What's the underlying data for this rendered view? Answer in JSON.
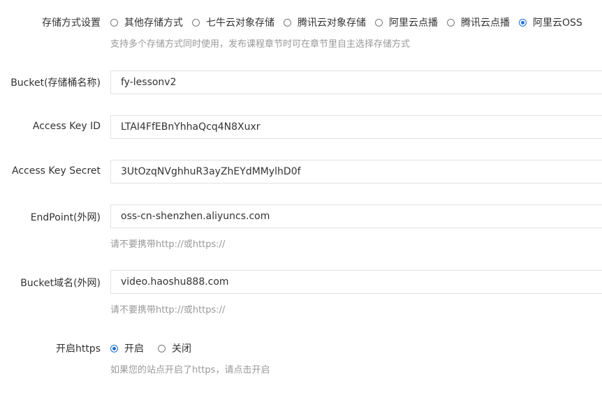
{
  "storage": {
    "label": "存储方式设置",
    "options": [
      "其他存储方式",
      "七牛云对象存储",
      "腾讯云对象存储",
      "阿里云点播",
      "腾讯云点播",
      "阿里云OSS"
    ],
    "hint": "支持多个存储方式同时使用，发布课程章节时可在章节里自主选择存储方式"
  },
  "bucket": {
    "label": "Bucket(存储桶名称)",
    "value": "fy-lessonv2"
  },
  "access_key_id": {
    "label": "Access Key ID",
    "value": "LTAI4FfEBnYhhaQcq4N8Xuxr"
  },
  "access_key_secret": {
    "label": "Access Key Secret",
    "value": "3UtOzqNVghhuR3ayZhEYdMMylhD0f"
  },
  "endpoint": {
    "label": "EndPoint(外网)",
    "value": "oss-cn-shenzhen.aliyuncs.com",
    "hint": "请不要携带http://或https://"
  },
  "bucket_domain": {
    "label": "Bucket域名(外网)",
    "value": "video.haoshu888.com",
    "hint": "请不要携带http://或https://"
  },
  "https": {
    "label": "开启https",
    "options": [
      "开启",
      "关闭"
    ],
    "hint": "如果您的站点开启了https，请点击开启"
  },
  "colors": {
    "accent": "#1e6fd9",
    "hint": "#999999",
    "border": "#e2e2e2"
  }
}
